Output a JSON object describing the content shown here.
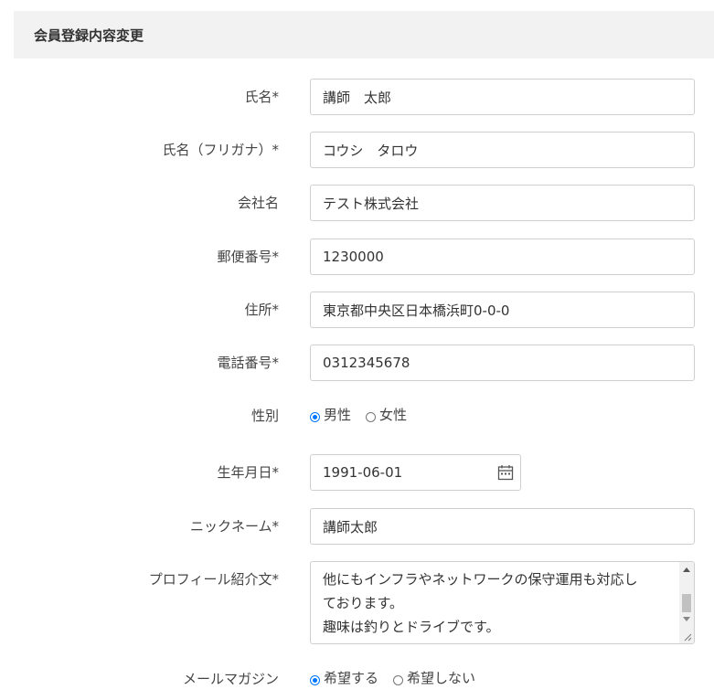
{
  "header": {
    "title": "会員登録内容変更"
  },
  "fields": {
    "name": {
      "label": "氏名*",
      "value": "講師　太郎"
    },
    "name_kana": {
      "label": "氏名（フリガナ）*",
      "value": "コウシ　タロウ"
    },
    "company": {
      "label": "会社名",
      "value": "テスト株式会社"
    },
    "zip": {
      "label": "郵便番号*",
      "value": "1230000"
    },
    "address": {
      "label": "住所*",
      "value": "東京都中央区日本橋浜町0-0-0"
    },
    "phone": {
      "label": "電話番号*",
      "value": "0312345678"
    },
    "gender": {
      "label": "性別",
      "options": [
        "男性",
        "女性"
      ],
      "selected": "男性"
    },
    "birthday": {
      "label": "生年月日*",
      "value": "1991-06-01"
    },
    "nickname": {
      "label": "ニックネーム*",
      "value": "講師太郎"
    },
    "profile": {
      "label": "プロフィール紹介文*",
      "value": "他にもインフラやネットワークの保守運用も対応し\nております。\n趣味は釣りとドライブです。"
    },
    "newsletter": {
      "label": "メールマガジン",
      "options": [
        "希望する",
        "希望しない"
      ],
      "selected": "希望する"
    }
  },
  "icons": {
    "calendar": "calendar-icon"
  },
  "colors": {
    "accent": "#0075ff",
    "header_bg": "#f2f2f2",
    "border": "#cfcfcf"
  }
}
